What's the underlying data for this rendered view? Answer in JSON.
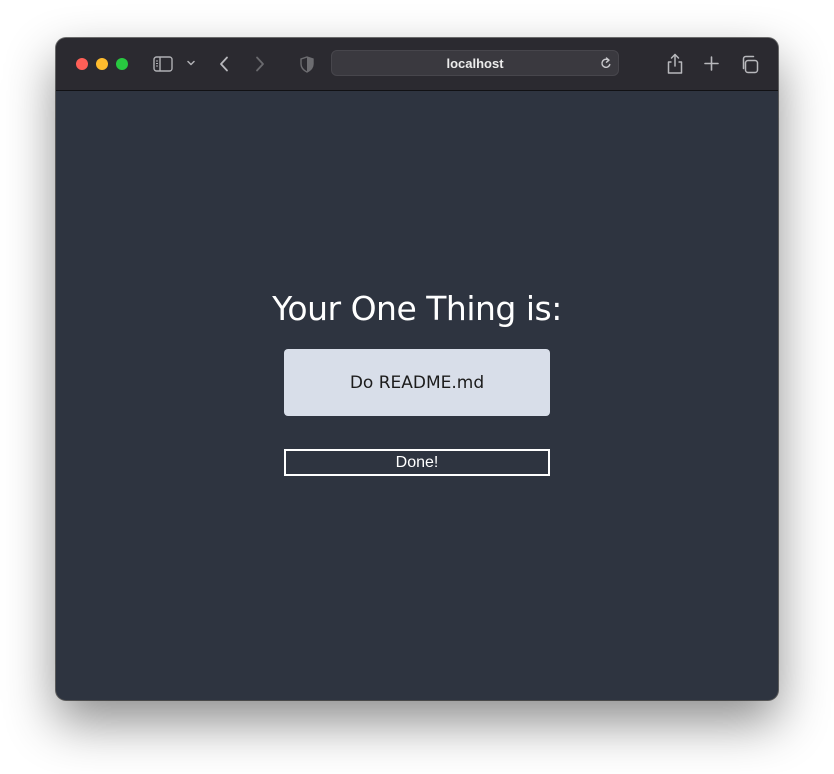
{
  "browser": {
    "url": "localhost",
    "icons": {
      "sidebar": "sidebar-icon",
      "chevron": "chevron-down-icon",
      "back": "back-icon",
      "forward": "forward-icon",
      "privacy": "shield-icon",
      "reload": "reload-icon",
      "share": "share-icon",
      "new_tab": "plus-icon",
      "tabs": "tabs-icon"
    }
  },
  "page": {
    "heading": "Your One Thing is:",
    "one_thing": "Do README.md",
    "done_label": "Done!"
  },
  "colors": {
    "background": "#2e3440",
    "card": "#d8dee9",
    "text": "#ffffff"
  }
}
